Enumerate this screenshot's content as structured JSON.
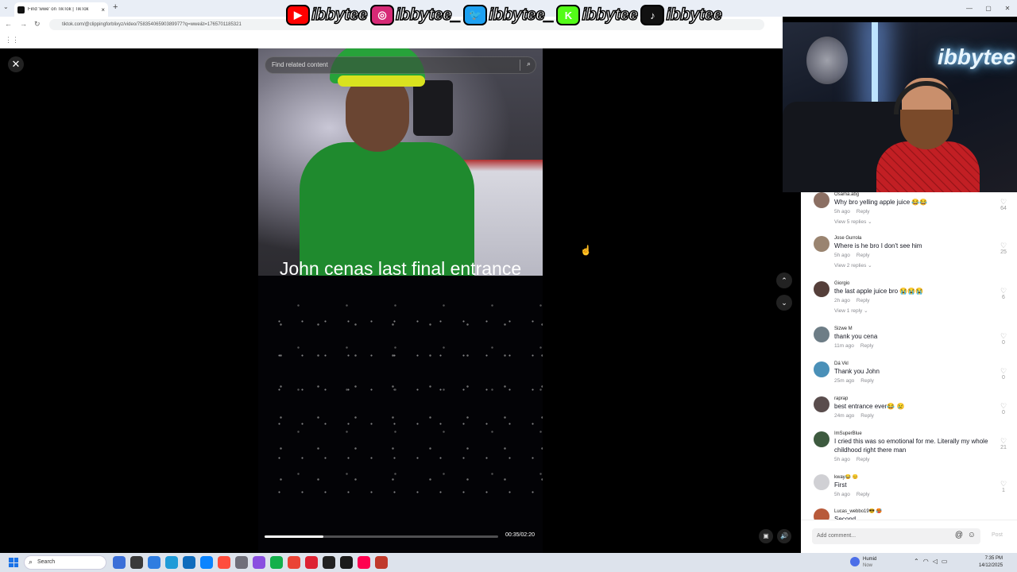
{
  "browser": {
    "tab_title": "Find 'wwe' on TikTok | TikTok",
    "url": "tiktok.com/@clippingforblixyz/video/75835406590389977?q=wwe&t=1765701185321",
    "new_tab_label": "+",
    "tab_close": "×",
    "window_controls": [
      "—",
      "▢",
      "✕"
    ]
  },
  "socials": [
    {
      "icon": "youtube-icon",
      "glyph": "▶",
      "color": "#ff0000",
      "handle": "ibbytee"
    },
    {
      "icon": "instagram-icon",
      "glyph": "◎",
      "color": "#d62976",
      "handle": "ibbytee_"
    },
    {
      "icon": "twitter-icon",
      "glyph": "🐦",
      "color": "#1da1f2",
      "handle": "ibbytee_"
    },
    {
      "icon": "kick-icon",
      "glyph": "K",
      "color": "#53fc18",
      "handle": "ibbytee"
    },
    {
      "icon": "tiktok-icon",
      "glyph": "♪",
      "color": "#111111",
      "handle": "ibbytee"
    }
  ],
  "video": {
    "search_placeholder": "Find related content",
    "caption": "John cenas last final entrance",
    "progress": 0.25,
    "time": "00:35/02:20"
  },
  "stream_overlay": {
    "neon_sign": "ibbytee"
  },
  "comments": [
    {
      "user": "Osama.abg",
      "text": "Why bro yelling apple juice 😂😂",
      "time": "5h ago",
      "reply": "Reply",
      "likes": "64",
      "view_replies": "View 5 replies ⌄",
      "avatar": "#8b6f63"
    },
    {
      "user": "Jose Gurrola",
      "text": "Where is he bro I don't see him",
      "time": "5h ago",
      "reply": "Reply",
      "likes": "25",
      "view_replies": "View 2 replies ⌄",
      "avatar": "#9a8470"
    },
    {
      "user": "Giorgio",
      "text": "the last apple juice bro 😭😭😭",
      "time": "2h ago",
      "reply": "Reply",
      "likes": "6",
      "view_replies": "View 1 reply ⌄",
      "avatar": "#553f3a"
    },
    {
      "user": "Sizwe M",
      "text": "thank you cena",
      "time": "11m ago",
      "reply": "Reply",
      "likes": "0",
      "view_replies": "",
      "avatar": "#6d7d86"
    },
    {
      "user": "Dá Vkl",
      "text": "Thank you John",
      "time": "25m ago",
      "reply": "Reply",
      "likes": "0",
      "view_replies": "",
      "avatar": "#4a90b8"
    },
    {
      "user": "raprap",
      "text": "best entrance ever😂 😢",
      "time": "24m ago",
      "reply": "Reply",
      "likes": "0",
      "view_replies": "",
      "avatar": "#5a4d4d"
    },
    {
      "user": "ImSuperBlue",
      "text": "I cried this was so emotional for me. Literally my whole childhood right there man",
      "time": "5h ago",
      "reply": "Reply",
      "likes": "21",
      "view_replies": "",
      "avatar": "#3d5a3f"
    },
    {
      "user": "kway😂 😊",
      "text": "First",
      "time": "5h ago",
      "reply": "Reply",
      "likes": "1",
      "view_replies": "",
      "avatar": "#d0d0d4"
    },
    {
      "user": "Lucas_webbo19😎 🥵",
      "text": "Second",
      "time": "",
      "reply": "",
      "likes": "",
      "view_replies": "",
      "avatar": "#b85a3a"
    }
  ],
  "composer": {
    "placeholder": "Add comment...",
    "post_label": "Post"
  },
  "taskbar": {
    "search_label": "Search",
    "weather_title": "Humid",
    "weather_sub": "Now",
    "time": "7:35 PM",
    "date": "14/12/2025",
    "app_colors": [
      "#3b6fd8",
      "#3a3a3a",
      "#2f7de1",
      "#1f9bd8",
      "#0f6cbd",
      "#0a84ff",
      "#ff4d3d",
      "#6f6f7a",
      "#8a4fe0",
      "#13b04b",
      "#ea4335",
      "#d23",
      "#222",
      "#1b1b1b",
      "#ff0050",
      "#c0392b"
    ]
  }
}
